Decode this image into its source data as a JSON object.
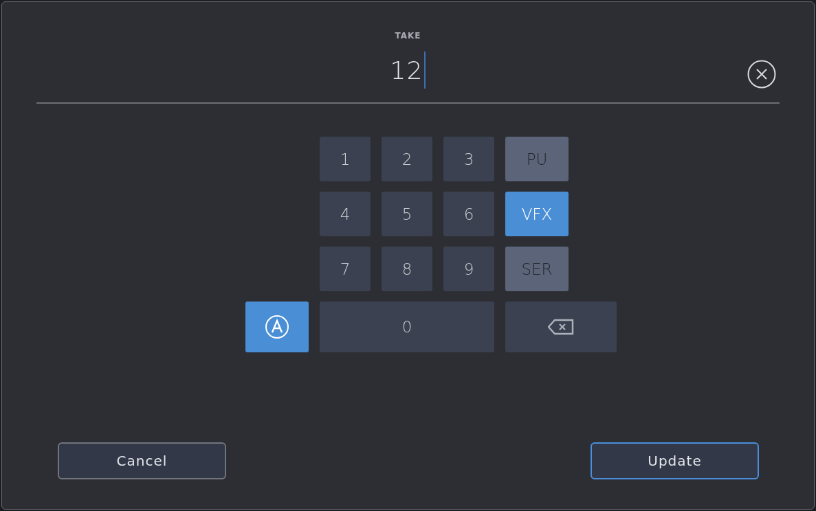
{
  "field": {
    "label": "TAKE",
    "value": "12"
  },
  "keys": [
    {
      "kind": "digit",
      "label": "1"
    },
    {
      "kind": "digit",
      "label": "2"
    },
    {
      "kind": "digit",
      "label": "3"
    },
    {
      "kind": "tag",
      "label": "PU",
      "selected": false
    },
    {
      "kind": "digit",
      "label": "4"
    },
    {
      "kind": "digit",
      "label": "5"
    },
    {
      "kind": "digit",
      "label": "6"
    },
    {
      "kind": "tag",
      "label": "VFX",
      "selected": true
    },
    {
      "kind": "digit",
      "label": "7"
    },
    {
      "kind": "digit",
      "label": "8"
    },
    {
      "kind": "digit",
      "label": "9"
    },
    {
      "kind": "tag",
      "label": "SER",
      "selected": false
    },
    {
      "kind": "alpha",
      "on": true
    },
    {
      "kind": "zero",
      "label": "0"
    },
    {
      "kind": "backspace"
    }
  ],
  "buttons": [
    {
      "label": "Cancel",
      "primary": false
    },
    {
      "label": "Update",
      "primary": true
    }
  ]
}
